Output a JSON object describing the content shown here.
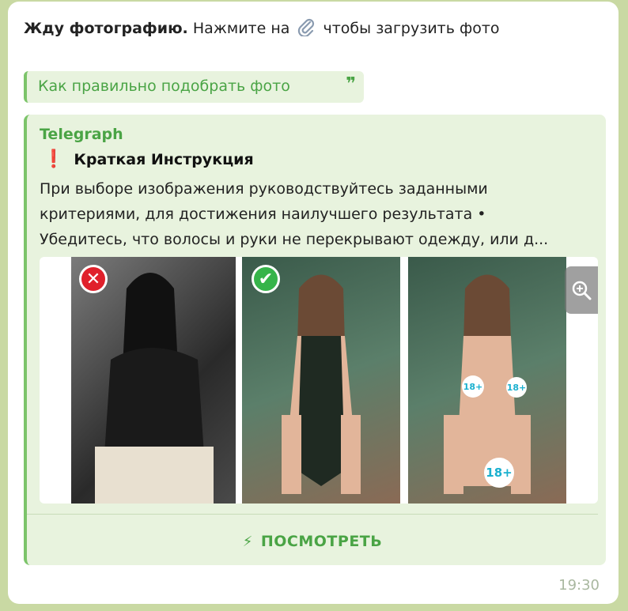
{
  "message": {
    "bold_text": "Жду фотографию.",
    "text_before_icon": "Нажмите на",
    "icon": "paperclip-icon",
    "text_after_icon": "чтобы загрузить фото",
    "time": "19:30"
  },
  "quote": {
    "label": "Как правильно подобрать фото",
    "mark": "❞"
  },
  "preview": {
    "site": "Telegraph",
    "title_icon": "❗",
    "title": "Краткая Инструкция",
    "lines": [
      "При выборе изображения руководствуйтесь заданными",
      "критериями, для достижения наилучшего результата •",
      "Убедитесь, что волосы и руки не перекрывают одежду, или д..."
    ],
    "badges": {
      "wrong": "✕",
      "correct": "✔",
      "sticker": "18+"
    },
    "button_label": "ПОСМОТРЕТЬ",
    "button_icon": "⚡"
  },
  "colors": {
    "accent": "#4aa445",
    "quote_bg": "#e8f3de",
    "wrong": "#e0202b",
    "correct": "#36b44a"
  }
}
